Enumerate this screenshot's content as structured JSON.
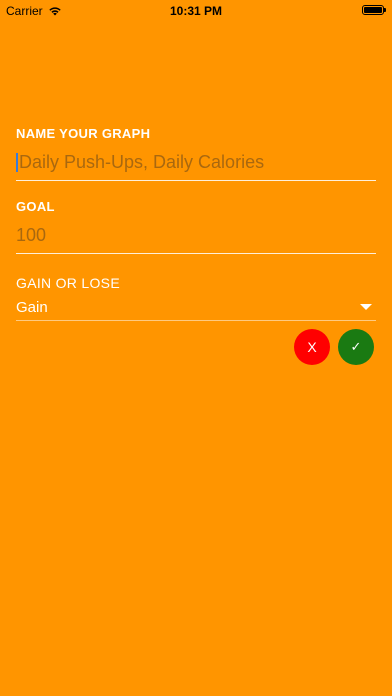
{
  "status_bar": {
    "carrier": "Carrier",
    "time": "10:31 PM"
  },
  "form": {
    "name": {
      "label": "NAME YOUR GRAPH",
      "placeholder": "Daily Push-Ups, Daily Calories",
      "value": ""
    },
    "goal": {
      "label": "GOAL",
      "placeholder": "100",
      "value": ""
    },
    "gain_or_lose": {
      "label": "GAIN OR LOSE",
      "selected": "Gain"
    }
  },
  "actions": {
    "cancel_label": "X",
    "confirm_label": "✓"
  },
  "colors": {
    "background": "#FF9500",
    "cancel": "#FF0000",
    "confirm": "#1A7A12"
  }
}
